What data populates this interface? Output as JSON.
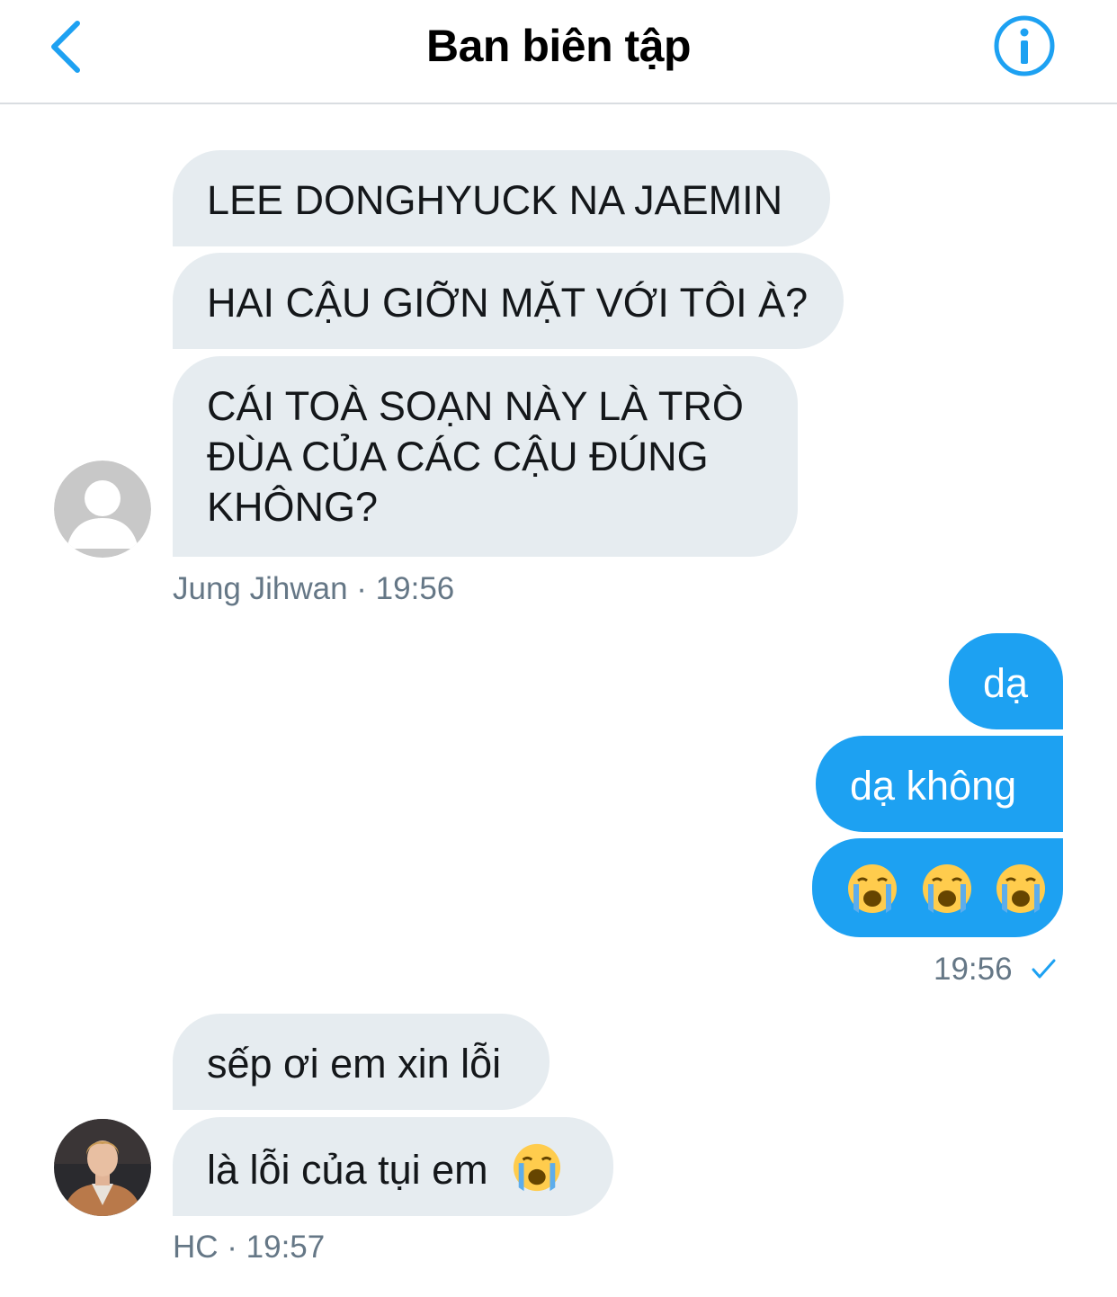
{
  "header": {
    "title": "Ban biên tập",
    "back_icon": "chevron-left-icon",
    "info_icon": "info-icon"
  },
  "colors": {
    "accent": "#1da1f2",
    "incoming_bubble": "#e6ecf0",
    "meta_text": "#657786"
  },
  "groups": [
    {
      "sender": "Jung Jihwan",
      "time": "19:56",
      "avatar": "default-avatar-icon",
      "messages": [
        "LEE DONGHYUCK NA JAEMIN",
        "HAI CẬU GIỠN MẶT VỚI TÔI À?",
        [
          "CÁI TOÀ SOẠN NÀY LÀ TRÒ",
          "ĐÙA CỦA CÁC CẬU ĐÚNG",
          "KHÔNG?"
        ]
      ]
    },
    {
      "sender": "me",
      "time": "19:56",
      "status_icon": "checkmark-icon",
      "messages": [
        "dạ",
        "dạ không",
        "😭😭😭"
      ]
    },
    {
      "sender": "HC",
      "time": "19:57",
      "avatar": "user-photo-avatar",
      "messages": [
        "sếp ơi em xin lỗi",
        "là lỗi của tụi em",
        "😭"
      ]
    }
  ],
  "meta": {
    "jihwan_line": "Jung Jihwan · 19:56",
    "my_time": "19:56",
    "hc_line": "HC · 19:57"
  }
}
